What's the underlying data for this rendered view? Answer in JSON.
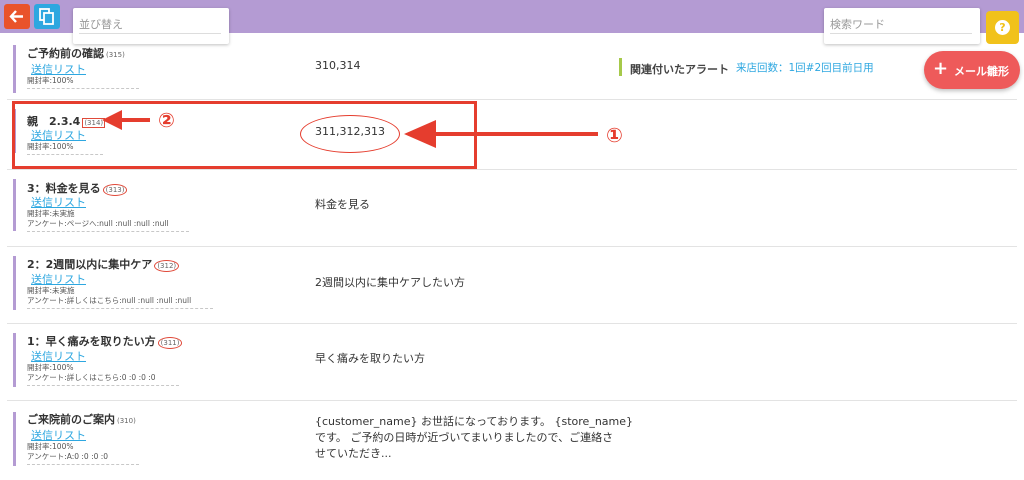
{
  "toolbar": {
    "sort_placeholder": "並び替え",
    "keyword_placeholder": "検索ワード",
    "help_label": "?",
    "mail_button_label": "メール雛形",
    "mail_button_plus": "+"
  },
  "alert": {
    "title": "関連付いたアラート",
    "link_text": "来店回数：1回#2回目前日用"
  },
  "rows": [
    {
      "title": "ご予約前の確認",
      "num": "(315)",
      "link": "送信リスト",
      "meta": [
        "開封率:100%"
      ],
      "content": [
        "310,314"
      ]
    },
    {
      "title": "親　2.3.4",
      "num": "(314)",
      "link": "送信リスト",
      "meta": [
        "開封率:100%"
      ],
      "content": [
        "311,312,313"
      ]
    },
    {
      "title": "3：料金を見る",
      "num": "(313)",
      "link": "送信リスト",
      "meta": [
        "開封率:未実施",
        "アンケート:ページへ:null :null :null :null"
      ],
      "content": [
        "料金を見る"
      ]
    },
    {
      "title": "2：2週間以内に集中ケア",
      "num": "(312)",
      "link": "送信リスト",
      "meta": [
        "開封率:未実施",
        "アンケート:詳しくはこちら:null :null :null :null"
      ],
      "content": [
        "2週間以内に集中ケアしたい方"
      ]
    },
    {
      "title": "1：早く痛みを取りたい方",
      "num": "(311)",
      "link": "送信リスト",
      "meta": [
        "開封率:100%",
        "アンケート:詳しくはこちら:0 :0 :0 :0"
      ],
      "content": [
        "早く痛みを取りたい方"
      ]
    },
    {
      "title": "ご来院前のご案内",
      "num": "(310)",
      "link": "送信リスト",
      "meta": [
        "開封率:100%",
        "アンケート:A:0 :0 :0 :0"
      ],
      "content": [
        "{customer_name} お世話になっております。 {store_name}",
        "です。 ご予約の日時が近づいてまいりましたので、ご連絡さ",
        "せていただき..."
      ]
    }
  ],
  "annotations": {
    "marker_1": "①",
    "marker_2": "②"
  },
  "colors": {
    "topbar": "#b49bd3",
    "back_button": "#e9532b",
    "copy_button": "#2ea7e0",
    "help_button": "#f1c21b",
    "mail_button": "#ee5a5a",
    "link": "#2ea7e0",
    "annotation_red": "#e53d2e",
    "alert_bar": "#a6c94a"
  }
}
